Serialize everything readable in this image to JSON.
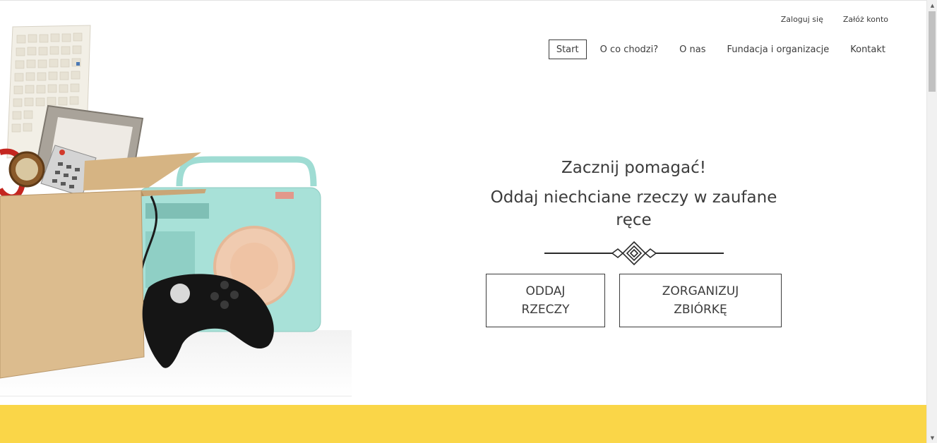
{
  "auth": {
    "login_label": "Zaloguj się",
    "register_label": "Załóż konto"
  },
  "nav": {
    "items": [
      {
        "label": "Start",
        "active": true
      },
      {
        "label": "O co chodzi?",
        "active": false
      },
      {
        "label": "O nas",
        "active": false
      },
      {
        "label": "Fundacja i organizacje",
        "active": false
      },
      {
        "label": "Kontakt",
        "active": false
      }
    ]
  },
  "hero": {
    "title": "Zacznij pomagać!",
    "subtitle": "Oddaj niechciane rzeczy w zaufane ręce",
    "decoration_icon": "ornament-divider-icon",
    "buttons": {
      "give_line1": "ODDAJ",
      "give_line2": "RZECZY",
      "collect_line1": "ZORGANIZUJ",
      "collect_line2": "ZBIÓRKĘ"
    }
  },
  "colors": {
    "accent_yellow": "#fad648",
    "text": "#3c3c3c",
    "radio_mint": "#9fdcd3",
    "box_cardboard": "#d9b98c"
  }
}
